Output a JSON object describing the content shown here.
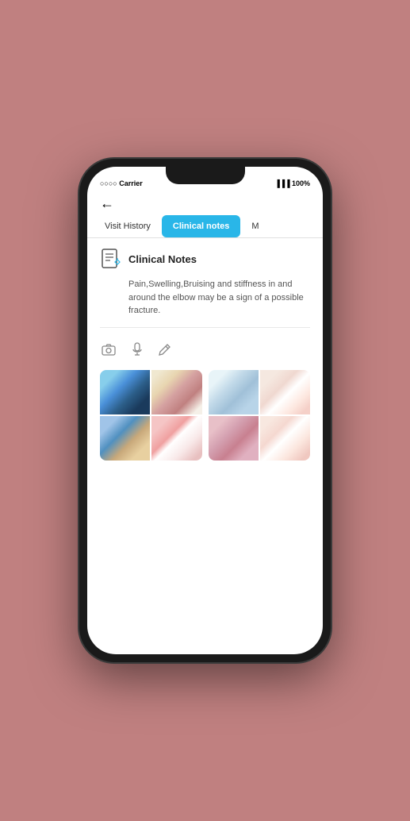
{
  "status_bar": {
    "carrier": "○○○○ Carrier",
    "time": "",
    "battery": "▐▐▐ 100%"
  },
  "tabs": [
    {
      "id": "visit-history",
      "label": "Visit History",
      "active": false
    },
    {
      "id": "clinical-notes",
      "label": "Clinical notes",
      "active": true
    },
    {
      "id": "more",
      "label": "M",
      "active": false
    }
  ],
  "clinical_notes": {
    "section_title": "Clinical Notes",
    "note_text": "Pain,Swelling,Bruising and stiffness in and around the elbow may be a sign of a possible fracture."
  },
  "action_icons": {
    "camera_label": "📷",
    "mic_label": "🎤",
    "edit_label": "✏"
  },
  "photos": {
    "group1": [
      {
        "id": "dental-chair",
        "alt": "Dentist with patient"
      },
      {
        "id": "braces-model",
        "alt": "Dental braces model"
      },
      {
        "id": "dentist-work",
        "alt": "Dentist performing procedure"
      },
      {
        "id": "smile-close",
        "alt": "Close up smile with braces"
      }
    ],
    "group2": [
      {
        "id": "exam-tool",
        "alt": "Dental examination"
      },
      {
        "id": "smile-white",
        "alt": "Smile closeup"
      },
      {
        "id": "lip-exam",
        "alt": "Lip examination"
      },
      {
        "id": "smile-bright",
        "alt": "Bright smile"
      }
    ]
  },
  "back_button": "←"
}
